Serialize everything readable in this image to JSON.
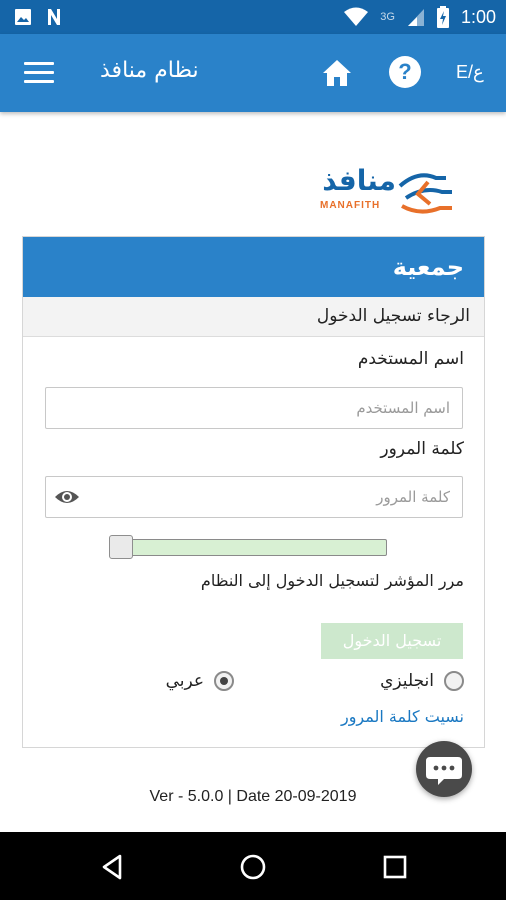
{
  "status_bar": {
    "network": "3G",
    "time": "1:00"
  },
  "app_bar": {
    "title": "نظام منافذ",
    "lang_toggle": "E/ع",
    "help_symbol": "?"
  },
  "logo": {
    "arabic": "منافذ",
    "english": "MANAFITH"
  },
  "card": {
    "header": "جمعية",
    "subtitle": "الرجاء تسجيل الدخول",
    "username": {
      "label": "اسم المستخدم",
      "placeholder": "اسم المستخدم",
      "value": ""
    },
    "password": {
      "label": "كلمة المرور",
      "placeholder": "كلمة المرور",
      "value": ""
    },
    "slider": {
      "hint": "مرر المؤشر لتسجيل الدخول إلى النظام",
      "progress": 0
    },
    "login_button": "تسجيل الدخول",
    "language_options": [
      {
        "label": "انجليزي",
        "selected": false
      },
      {
        "label": "عربي",
        "selected": true
      }
    ],
    "forgot_password": "نسيت كلمة المرور"
  },
  "version": "Ver - 5.0.0 | Date 20-09-2019",
  "colors": {
    "status_bar": "#1565a8",
    "app_bar": "#2a82c9",
    "slider_fill": "#d8f0d3",
    "login_button_disabled": "#cde8cd",
    "link": "#1a78c2",
    "logo_orange": "#e8702a"
  },
  "icons": [
    "image-icon",
    "n-notification-icon",
    "wifi-icon",
    "signal-icon",
    "battery-icon",
    "menu-icon",
    "home-icon",
    "help-icon",
    "eye-icon",
    "chat-icon",
    "back-icon",
    "home-circle-icon",
    "recents-icon"
  ]
}
